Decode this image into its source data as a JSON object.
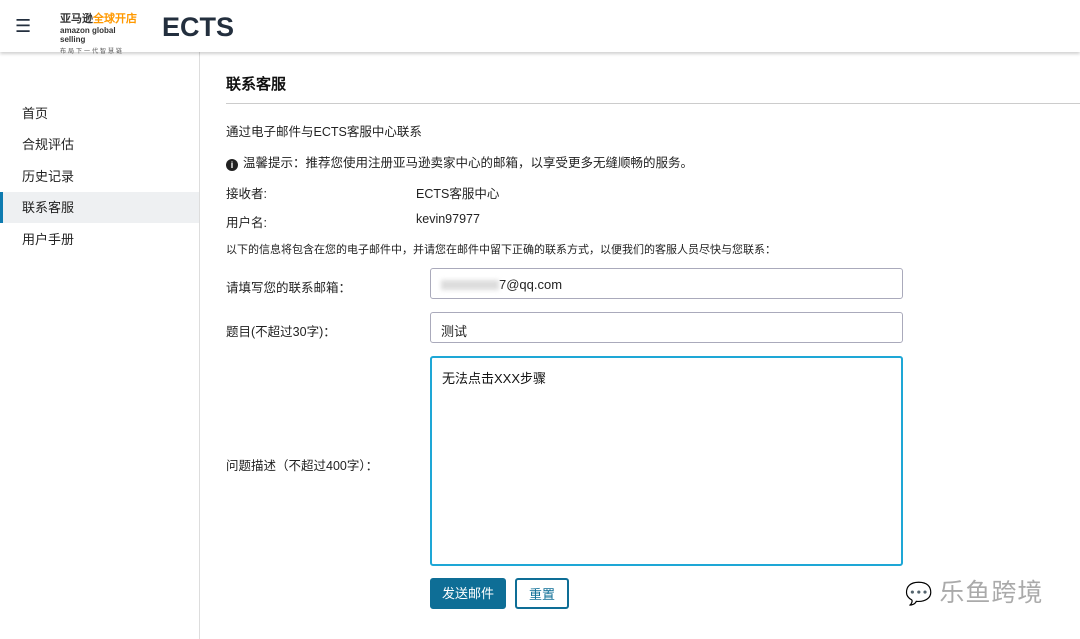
{
  "header": {
    "logo_line1": "亚马逊",
    "logo_line1_accent": "全球开店",
    "logo_line2": "amazon global selling",
    "logo_line3": "布局下一代智慧链",
    "brand": "ECTS"
  },
  "sidebar": {
    "items": [
      {
        "label": "首页"
      },
      {
        "label": "合规评估"
      },
      {
        "label": "历史记录"
      },
      {
        "label": "联系客服"
      },
      {
        "label": "用户手册"
      }
    ]
  },
  "main": {
    "title": "联系客服",
    "intro": "通过电子邮件与ECTS客服中心联系",
    "tip": "温馨提示：推荐您使用注册亚马逊卖家中心的邮箱，以享受更多无缝顺畅的服务。",
    "receiver_label": "接收者:",
    "receiver_value": "ECTS客服中心",
    "username_label": "用户名:",
    "username_value": "kevin97977",
    "notice": "以下的信息将包含在您的电子邮件中，并请您在邮件中留下正确的联系方式，以便我们的客服人员尽快与您联系：",
    "email_label": "请填写您的联系邮箱：",
    "email_value": "7@qq.com",
    "subject_label": "题目(不超过30字)：",
    "subject_value": "测试",
    "desc_label": "问题描述（不超过400字）：",
    "desc_value": "无法点击XXX步骤",
    "send_button": "发送邮件",
    "reset_button": "重置"
  },
  "watermark": "乐鱼跨境"
}
